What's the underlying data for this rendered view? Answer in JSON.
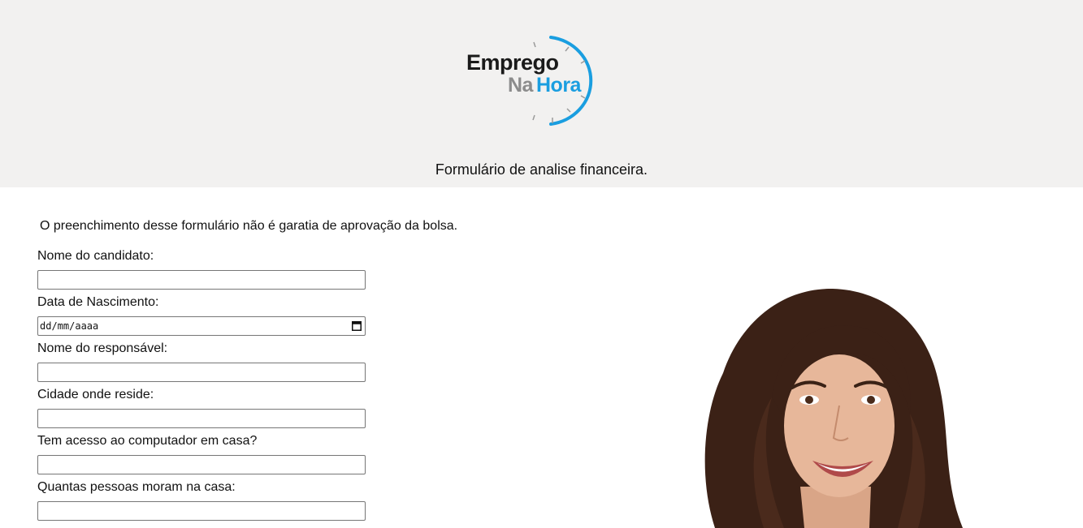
{
  "header": {
    "logo": {
      "line1": "Emprego",
      "line2a": "Na",
      "line2b": "Hora",
      "accent": "#1a9ee0",
      "gray": "#8c8c8c"
    },
    "title": "Formulário de analise financeira."
  },
  "main": {
    "disclaimer": "O preenchimento desse formulário não é garatia de aprovação da bolsa.",
    "fields": [
      {
        "label": "Nome do candidato:",
        "value": ""
      },
      {
        "label": "Data de Nascimento:",
        "placeholder": "dd/mm/aaaa"
      },
      {
        "label": "Nome do responsável:",
        "value": ""
      },
      {
        "label": "Cidade onde reside:",
        "value": ""
      },
      {
        "label": "Tem acesso ao computador em casa?",
        "value": ""
      },
      {
        "label": "Quantas pessoas moram na casa:",
        "value": ""
      }
    ]
  },
  "icons": {
    "calendar": "calendar-icon",
    "clock": "clock-icon"
  }
}
